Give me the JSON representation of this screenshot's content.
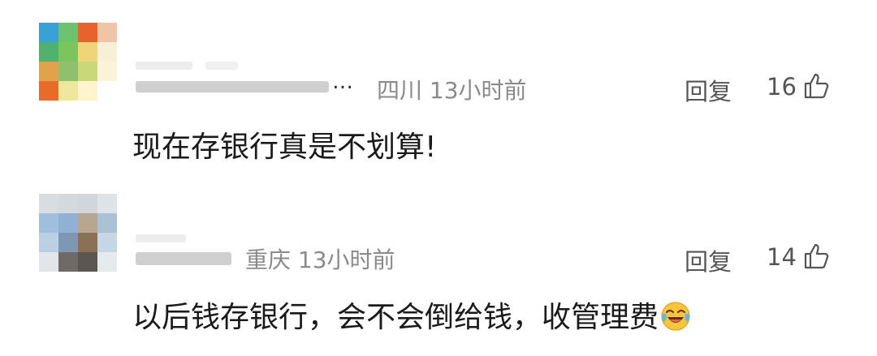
{
  "comments": [
    {
      "location": "四川",
      "time": "13小时前",
      "reply_label": "回复",
      "likes": "16",
      "text": "现在存银行真是不划算!",
      "nickname_ellipsis": "…",
      "avatar_colors": [
        "#3aa1d6",
        "#6dc36d",
        "#e8632c",
        "#f0c4a8",
        "#4fb36f",
        "#7cc45c",
        "#f0d47a",
        "#f6f0d6",
        "#e0a24b",
        "#8fc16c",
        "#c9d97a",
        "#fbf3d9",
        "#e86b2a",
        "#efe79b",
        "#fff4cc",
        "#ffffff"
      ]
    },
    {
      "location": "重庆",
      "time": "13小时前",
      "reply_label": "回复",
      "likes": "14",
      "text": "以后钱存银行，会不会倒给钱，收管理费",
      "emoji": "face-with-tears-of-joy",
      "avatar_colors": [
        "#d9dde2",
        "#d4d9de",
        "#d2d6da",
        "#dfe2e6",
        "#9fbfdc",
        "#8fb1d3",
        "#b8a690",
        "#a9c2d8",
        "#bcd0e3",
        "#7f97b2",
        "#8a7055",
        "#c7d6e4",
        "#e2e6ea",
        "#6e6a66",
        "#5c5550",
        "#e7eaed"
      ]
    }
  ]
}
